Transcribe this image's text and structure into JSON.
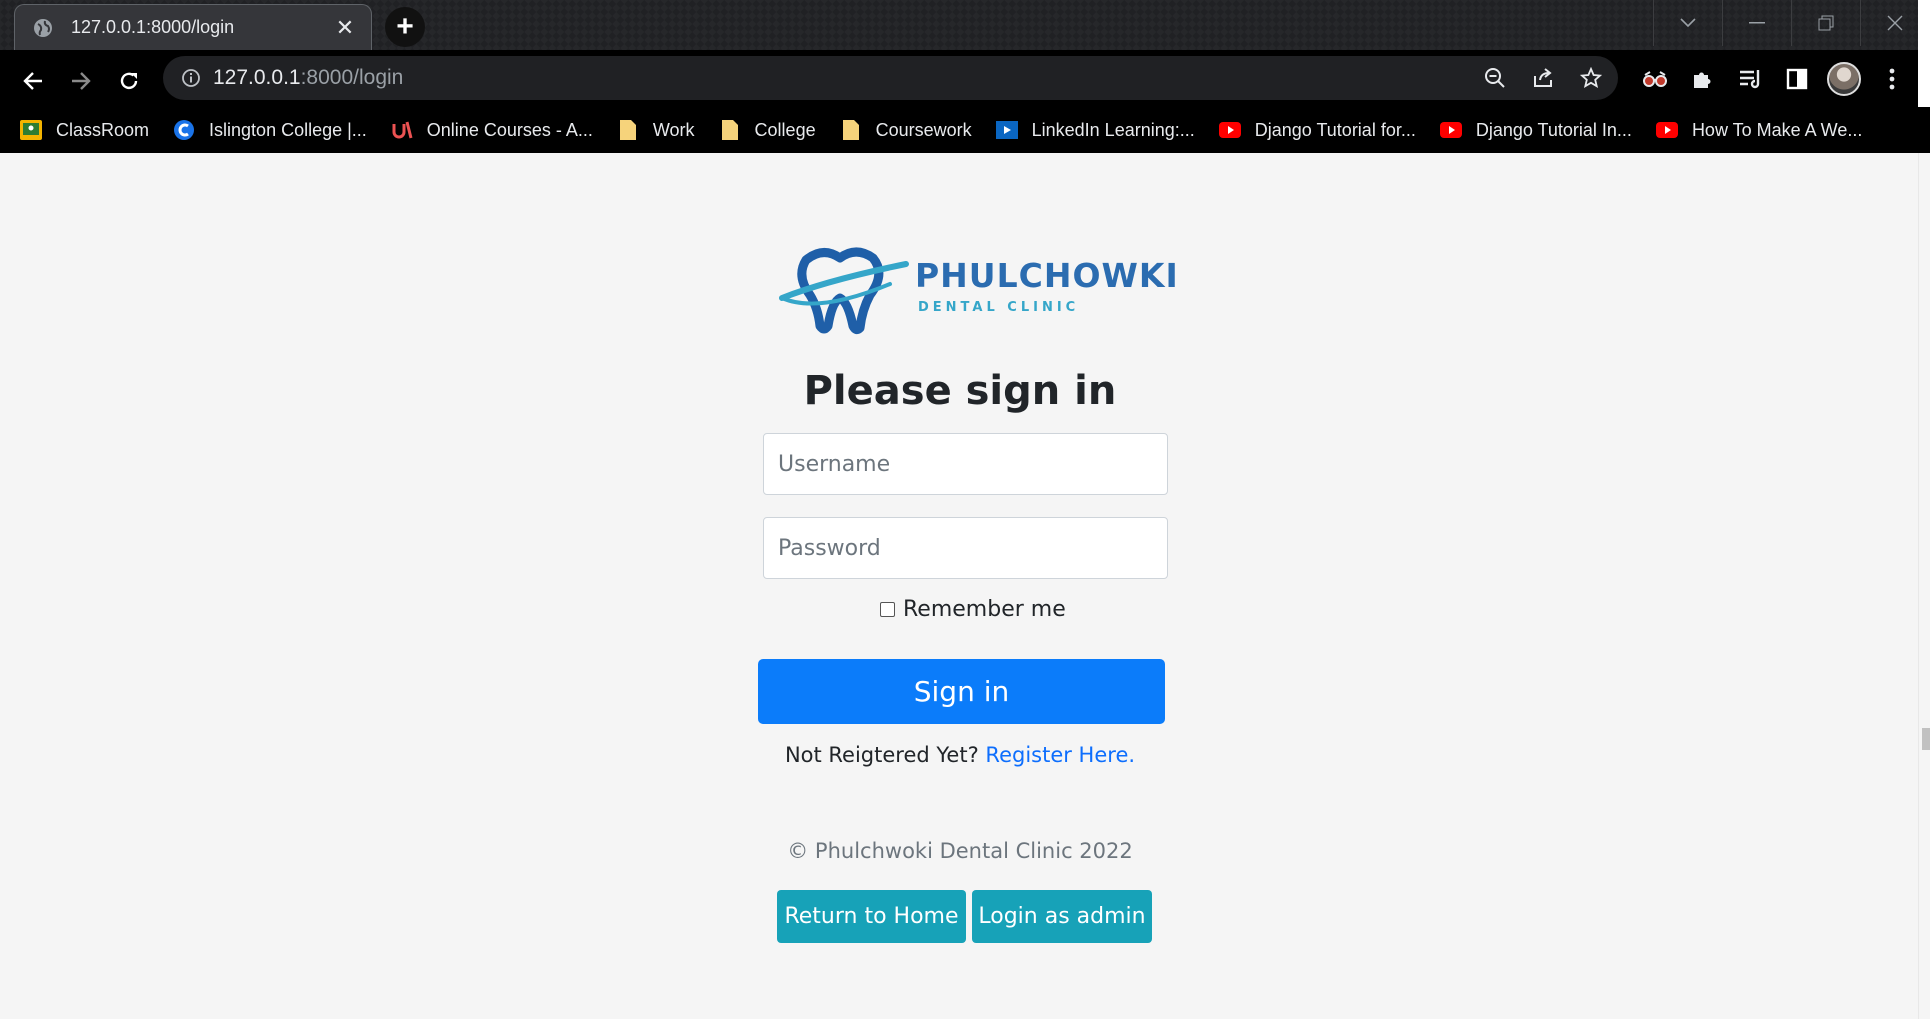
{
  "browser": {
    "tab_title": "127.0.0.1:8000/login",
    "tab_close": "✕",
    "new_tab": "+",
    "url_host": "127.0.0.1",
    "url_rest": ":8000/login",
    "window_controls": [
      "chevron-down",
      "minimize",
      "restore",
      "close"
    ],
    "bookmarks": [
      {
        "label": "ClassRoom",
        "icon": "classroom-icon",
        "color": "#f4b400"
      },
      {
        "label": "Islington College |...",
        "icon": "islington-icon",
        "color": "#1a73e8"
      },
      {
        "label": "Online Courses - A...",
        "icon": "udemy-icon",
        "color": "#ec5252"
      },
      {
        "label": "Work",
        "icon": "folder-icon",
        "color": "#f6d37b"
      },
      {
        "label": "College",
        "icon": "folder-icon",
        "color": "#f6d37b"
      },
      {
        "label": "Coursework",
        "icon": "folder-icon",
        "color": "#f6d37b"
      },
      {
        "label": "LinkedIn Learning:...",
        "icon": "linkedin-learning-icon",
        "color": "#0a66c2"
      },
      {
        "label": "Django Tutorial for...",
        "icon": "youtube-icon",
        "color": "#ff0000"
      },
      {
        "label": "Django Tutorial In...",
        "icon": "youtube-icon",
        "color": "#ff0000"
      },
      {
        "label": "How To Make A We...",
        "icon": "youtube-icon",
        "color": "#ff0000"
      }
    ]
  },
  "page": {
    "logo": {
      "brand": "PHULCHOWKI",
      "sub": "DENTAL CLINIC"
    },
    "heading": "Please sign in",
    "username_placeholder": "Username",
    "password_placeholder": "Password",
    "remember_label": "Remember me",
    "signin_label": "Sign in",
    "register_prefix": "Not Reigtered Yet?",
    "register_link": "Register Here.",
    "footer": "© Phulchwoki Dental Clinic 2022",
    "return_home": "Return to Home",
    "login_admin": "Login as admin",
    "colors": {
      "primary": "#0b7cfa",
      "teal": "#17a2b8",
      "link": "#0d6efd"
    }
  }
}
